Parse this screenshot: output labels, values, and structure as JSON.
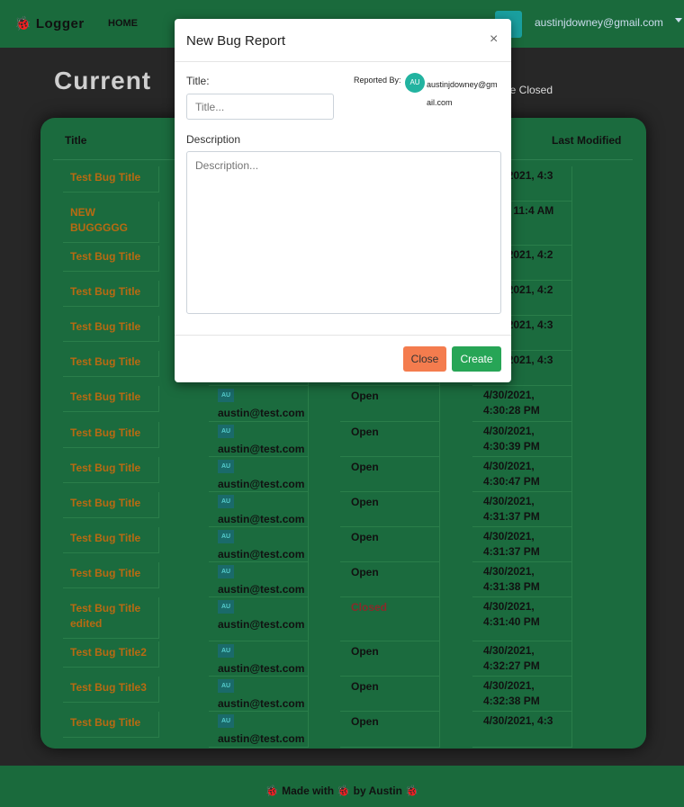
{
  "navbar": {
    "brand": "🐞 Logger",
    "home": "HOME",
    "user_email": "austinjdowney@gmail.com"
  },
  "page": {
    "heading": "Current",
    "filter_label": "le Closed"
  },
  "table": {
    "headers": {
      "title": "Title",
      "last_modified": "Last Modified"
    },
    "rows": [
      {
        "title": "Test Bug Title",
        "reporter": "",
        "avatar": "",
        "status": "",
        "modified": "4/30/2021, 4:3 PM"
      },
      {
        "title": "NEW BUGGGGG",
        "reporter": "",
        "avatar": "",
        "status": "",
        "modified": "2021, 11:4 AM"
      },
      {
        "title": "Test Bug Title",
        "reporter": "",
        "avatar": "",
        "status": "",
        "modified": "4/30/2021, 4:2 PM"
      },
      {
        "title": "Test Bug Title",
        "reporter": "",
        "avatar": "",
        "status": "",
        "modified": "4/30/2021, 4:2 PM"
      },
      {
        "title": "Test Bug Title",
        "reporter": "",
        "avatar": "",
        "status": "",
        "modified": "4/30/2021, 4:3 PM"
      },
      {
        "title": "Test Bug Title",
        "reporter": "com",
        "avatar": "",
        "status": "",
        "modified": "4/30/2021, 4:3 PM"
      },
      {
        "title": "Test Bug Title",
        "reporter": "austin@test.com",
        "avatar": "AU",
        "status": "Open",
        "modified": "4/30/2021, 4:30:28 PM"
      },
      {
        "title": "Test Bug Title",
        "reporter": "austin@test.com",
        "avatar": "AU",
        "status": "Open",
        "modified": "4/30/2021, 4:30:39 PM"
      },
      {
        "title": "Test Bug Title",
        "reporter": "austin@test.com",
        "avatar": "AU",
        "status": "Open",
        "modified": "4/30/2021, 4:30:47 PM"
      },
      {
        "title": "Test Bug Title",
        "reporter": "austin@test.com",
        "avatar": "AU",
        "status": "Open",
        "modified": "4/30/2021, 4:31:37 PM"
      },
      {
        "title": "Test Bug Title",
        "reporter": "austin@test.com",
        "avatar": "AU",
        "status": "Open",
        "modified": "4/30/2021, 4:31:37 PM"
      },
      {
        "title": "Test Bug Title",
        "reporter": "austin@test.com",
        "avatar": "AU",
        "status": "Open",
        "modified": "4/30/2021, 4:31:38 PM"
      },
      {
        "title": "Test Bug Title edited",
        "reporter": "austin@test.com",
        "avatar": "AU",
        "status": "Closed",
        "modified": "4/30/2021, 4:31:40 PM"
      },
      {
        "title": "Test Bug Title2",
        "reporter": "austin@test.com",
        "avatar": "AU",
        "status": "Open",
        "modified": "4/30/2021, 4:32:27 PM"
      },
      {
        "title": "Test Bug Title3",
        "reporter": "austin@test.com",
        "avatar": "AU",
        "status": "Open",
        "modified": "4/30/2021, 4:32:38 PM"
      },
      {
        "title": "Test Bug Title",
        "reporter": "austin@test.com",
        "avatar": "AU",
        "status": "Open",
        "modified": "4/30/2021, 4:3"
      }
    ]
  },
  "footer": {
    "text": "🐞 Made with 🐞 by Austin 🐞"
  },
  "modal": {
    "title": "New Bug Report",
    "close_icon": "×",
    "title_label": "Title:",
    "title_placeholder": "Title...",
    "reported_by_label": "Reported By:",
    "reporter_avatar": "AU",
    "reporter_email": "austinjdowney@gmail.com",
    "description_label": "Description",
    "description_placeholder": "Description...",
    "close_button": "Close",
    "create_button": "Create"
  }
}
